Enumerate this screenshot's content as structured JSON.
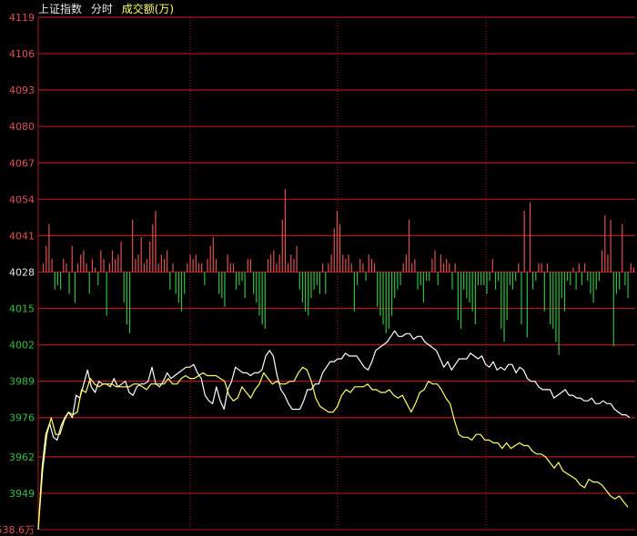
{
  "header": {
    "index_name": "上证指数",
    "mode": "分时",
    "indicator": "成交额(万)"
  },
  "colors": {
    "background": "#000000",
    "grid": "#b01818",
    "axis_label": "#e05050",
    "base_label": "#e8e8e8",
    "below_label": "#30c040",
    "up_bar": "#e05050",
    "down_bar": "#30c040",
    "price_line": "#ffffff",
    "avg_line": "#ffff66",
    "header_text": "#e8e8e8",
    "indicator_text": "#ffff66"
  },
  "chart_data": {
    "type": "line",
    "ylim": [
      3936,
      4119
    ],
    "y_ticks": [
      "4119",
      "4106",
      "4093",
      "4080",
      "4067",
      "4054",
      "4041",
      "4028",
      "4015",
      "4002",
      "3989",
      "3976",
      "3962",
      "3949"
    ],
    "base_value": 4028,
    "corner_label": "538.6万",
    "series": [
      {
        "key": "price",
        "values": [
          3936,
          3958,
          3970,
          3974,
          3969,
          3968,
          3973,
          3976,
          3978,
          3976,
          3984,
          3983,
          3988,
          3993,
          3987,
          3985,
          3989,
          3988,
          3988,
          3987,
          3990,
          3987,
          3988,
          3989,
          3985,
          3984,
          3987,
          3988,
          3988,
          3989,
          3994,
          3988,
          3987,
          3989,
          3992,
          3990,
          3991,
          3992,
          3993,
          3994,
          3994,
          3995,
          3992,
          3990,
          3984,
          3982,
          3981,
          3987,
          3982,
          3979,
          3986,
          3989,
          3994,
          3993,
          3992,
          3992,
          3991,
          3992,
          3992,
          3993,
          3998,
          4000,
          3998,
          3991,
          3986,
          3984,
          3981,
          3979,
          3979,
          3979,
          3982,
          3986,
          3986,
          3988,
          3988,
          3992,
          3994,
          3996,
          3996,
          3997,
          3997,
          3999,
          3998,
          3998,
          3998,
          3996,
          3994,
          3993,
          3996,
          4000,
          4001,
          4002,
          4003,
          4005,
          4007,
          4005,
          4005,
          4006,
          4006,
          4004,
          4005,
          4005,
          4003,
          4002,
          4001,
          4000,
          3997,
          3994,
          3996,
          3993,
          3995,
          3997,
          3997,
          3997,
          3999,
          3998,
          3997,
          3998,
          3995,
          3994,
          3996,
          3993,
          3994,
          3993,
          3995,
          3995,
          3992,
          3994,
          3993,
          3990,
          3989,
          3989,
          3987,
          3986,
          3986,
          3986,
          3983,
          3984,
          3985,
          3986,
          3984,
          3984,
          3983,
          3983,
          3982,
          3982,
          3983,
          3981,
          3981,
          3982,
          3981,
          3981,
          3979,
          3978,
          3977,
          3977,
          3976
        ]
      },
      {
        "key": "average",
        "values": [
          3936,
          3957,
          3970,
          3976,
          3970,
          3970,
          3975,
          3978,
          3977,
          3978,
          3986,
          3985,
          3990,
          3988,
          3987,
          3988,
          3988,
          3988,
          3987,
          3987,
          3987,
          3987,
          3988,
          3988,
          3987,
          3986,
          3988,
          3988,
          3988,
          3988,
          3990,
          3988,
          3988,
          3990,
          3991,
          3990,
          3990,
          3991,
          3992,
          3991,
          3991,
          3991,
          3990,
          3989,
          3984,
          3982,
          3983,
          3987,
          3985,
          3983,
          3986,
          3988,
          3992,
          3990,
          3988,
          3989,
          3988,
          3988,
          3989,
          3989,
          3992,
          3994,
          3993,
          3989,
          3983,
          3980,
          3979,
          3978,
          3978,
          3980,
          3984,
          3986,
          3985,
          3987,
          3987,
          3987,
          3988,
          3986,
          3986,
          3985,
          3985,
          3986,
          3984,
          3983,
          3984,
          3981,
          3978,
          3981,
          3985,
          3986,
          3989,
          3988,
          3988,
          3986,
          3983,
          3981,
          3975,
          3970,
          3969,
          3969,
          3968,
          3970,
          3970,
          3968,
          3968,
          3967,
          3967,
          3965,
          3967,
          3965,
          3966,
          3967,
          3966,
          3966,
          3964,
          3963,
          3963,
          3962,
          3960,
          3958,
          3960,
          3957,
          3956,
          3955,
          3954,
          3952,
          3951,
          3954,
          3953,
          3953,
          3952,
          3950,
          3948,
          3947,
          3948,
          3946,
          3944
        ]
      }
    ],
    "volume_bars": [
      2,
      6,
      11,
      3,
      -4,
      -3,
      -4,
      3,
      2,
      -5,
      6,
      -7,
      2,
      4,
      5,
      2,
      -5,
      3,
      1,
      -3,
      5,
      3,
      -10,
      2,
      5,
      3,
      4,
      7,
      -7,
      -12,
      -14,
      12,
      3,
      4,
      8,
      2,
      3,
      7,
      11,
      14,
      2,
      4,
      3,
      5,
      -4,
      2,
      -5,
      -7,
      -9,
      -5,
      2,
      4,
      3,
      4,
      2,
      2,
      -3,
      3,
      6,
      8,
      3,
      -5,
      -6,
      -8,
      4,
      2,
      2,
      -4,
      -3,
      -2,
      -6,
      3,
      3,
      -5,
      -7,
      -10,
      -12,
      -13,
      3,
      4,
      5,
      2,
      4,
      12,
      19,
      2,
      4,
      3,
      6,
      -4,
      -7,
      -9,
      -10,
      -6,
      -4,
      -3,
      -5,
      2,
      -5,
      2,
      4,
      10,
      14,
      11,
      4,
      3,
      4,
      2,
      -9,
      -3,
      3,
      2,
      -2,
      4,
      3,
      2,
      -8,
      -10,
      -12,
      -14,
      -13,
      -10,
      -6,
      -4,
      -3,
      2,
      4,
      12,
      2,
      3,
      -4,
      -3,
      -7,
      -2,
      -2,
      3,
      5,
      -3,
      4,
      2,
      3,
      2,
      -4,
      2,
      -11,
      -13,
      -4,
      -6,
      -7,
      -9,
      -12,
      -3,
      -3,
      -3,
      -5,
      -2,
      3,
      -4,
      -2,
      -13,
      -16,
      -11,
      -3,
      -4,
      -2,
      2,
      -12,
      14,
      -15,
      16,
      -4,
      -2,
      2,
      2,
      -9,
      2,
      -12,
      -13,
      -16,
      -19,
      -6,
      -9,
      -2,
      -3,
      1,
      -4,
      2,
      -3,
      2,
      -2,
      -5,
      -7,
      -4,
      -2,
      5,
      13,
      4,
      12,
      -17,
      -5,
      -4,
      11,
      -3,
      -6,
      2,
      1
    ]
  }
}
